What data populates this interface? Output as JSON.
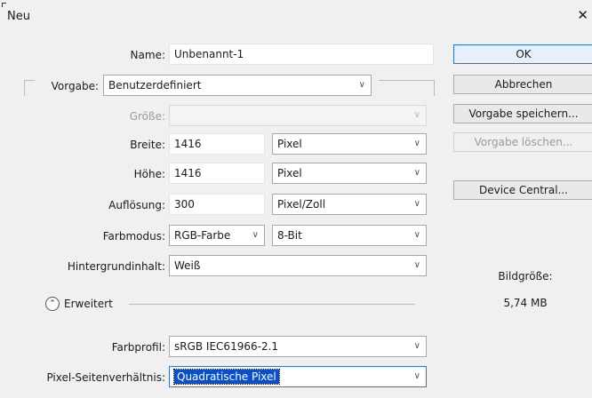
{
  "window": {
    "title": "Neu",
    "close_glyph": "✕"
  },
  "form": {
    "name_label": "Name:",
    "name_value": "Unbenannt-1",
    "preset_label": "Vorgabe:",
    "preset_value": "Benutzerdefiniert",
    "size_label": "Größe:",
    "size_value": "",
    "width_label": "Breite:",
    "width_value": "1416",
    "width_unit": "Pixel",
    "height_label": "Höhe:",
    "height_value": "1416",
    "height_unit": "Pixel",
    "resolution_label": "Auflösung:",
    "resolution_value": "300",
    "resolution_unit": "Pixel/Zoll",
    "colormode_label": "Farbmodus:",
    "colormode_value": "RGB-Farbe",
    "bitdepth_value": "8-Bit",
    "background_label": "Hintergrundinhalt:",
    "background_value": "Weiß",
    "advanced_label": "Erweitert",
    "expand_glyph": "⌃",
    "profile_label": "Farbprofil:",
    "profile_value": "sRGB IEC61966-2.1",
    "aspect_label": "Pixel-Seitenverhältnis:",
    "aspect_value": "Quadratische Pixel",
    "chevron": "∨"
  },
  "buttons": {
    "ok": "OK",
    "cancel": "Abbrechen",
    "save_preset": "Vorgabe speichern...",
    "delete_preset": "Vorgabe löschen...",
    "device_central": "Device Central..."
  },
  "info": {
    "size_label": "Bildgröße:",
    "size_value": "5,74 MB"
  },
  "colors": {
    "accent": "#2f73d9",
    "selection": "#0a4fc8"
  }
}
